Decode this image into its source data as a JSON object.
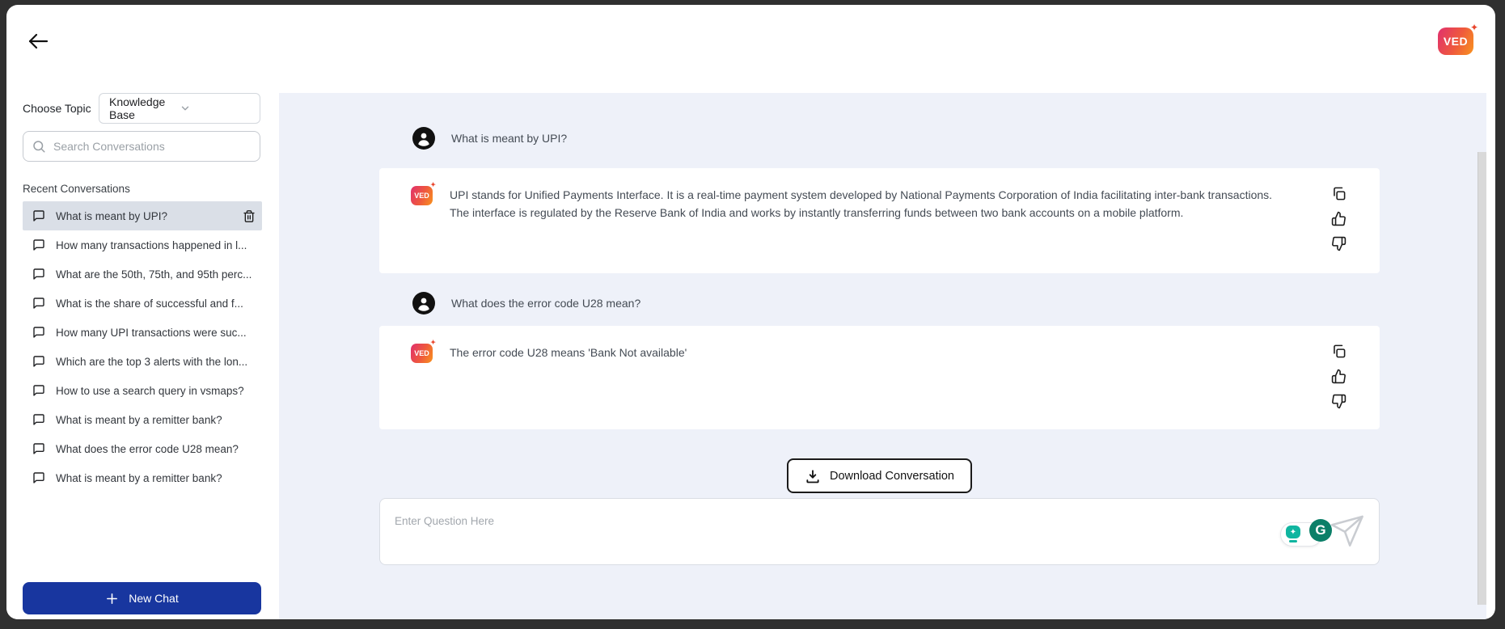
{
  "window": {
    "back_label": "back"
  },
  "brand": {
    "name": "VED",
    "sparkle": "✦"
  },
  "sidebar": {
    "choose_topic_label": "Choose Topic",
    "topic_value": "Knowledge Base",
    "search_placeholder": "Search Conversations",
    "recent_heading": "Recent Conversations",
    "conversations": [
      {
        "label": "What is meant by UPI?",
        "selected": true
      },
      {
        "label": "How many transactions happened in l...",
        "selected": false
      },
      {
        "label": "What are the 50th, 75th, and 95th perc...",
        "selected": false
      },
      {
        "label": "What is the share of successful and f...",
        "selected": false
      },
      {
        "label": "How many UPI transactions were suc...",
        "selected": false
      },
      {
        "label": "Which are the top 3 alerts with the lon...",
        "selected": false
      },
      {
        "label": "How to use a search query in vsmaps?",
        "selected": false
      },
      {
        "label": "What is meant by a remitter bank?",
        "selected": false
      },
      {
        "label": "What does the error code U28 mean?",
        "selected": false
      },
      {
        "label": "What is meant by a remitter bank?",
        "selected": false
      }
    ],
    "new_chat_label": "New Chat"
  },
  "chat": {
    "messages": [
      {
        "role": "user",
        "text": "What is meant by UPI?"
      },
      {
        "role": "bot",
        "text": "UPI stands for Unified Payments Interface. It is a real-time payment system developed by National Payments Corporation of India facilitating inter-bank transactions. The interface is regulated by the Reserve Bank of India and works by instantly transferring funds between two bank accounts on a mobile platform."
      },
      {
        "role": "user",
        "text": "What does the error code U28 mean?"
      },
      {
        "role": "bot",
        "text": "The error code U28 means 'Bank Not available'"
      }
    ],
    "download_label": "Download Conversation",
    "input_placeholder": "Enter Question Here",
    "grammarly_letter": "G"
  },
  "colors": {
    "accent_blue": "#18369f",
    "panel_background": "#eef1f9",
    "selected_item": "#dadfe7",
    "logo_gradient_start": "#e0306e",
    "logo_gradient_end": "#f8941e",
    "grammarly_green": "#0b7f68",
    "grammarly_teal": "#10b5a0"
  }
}
